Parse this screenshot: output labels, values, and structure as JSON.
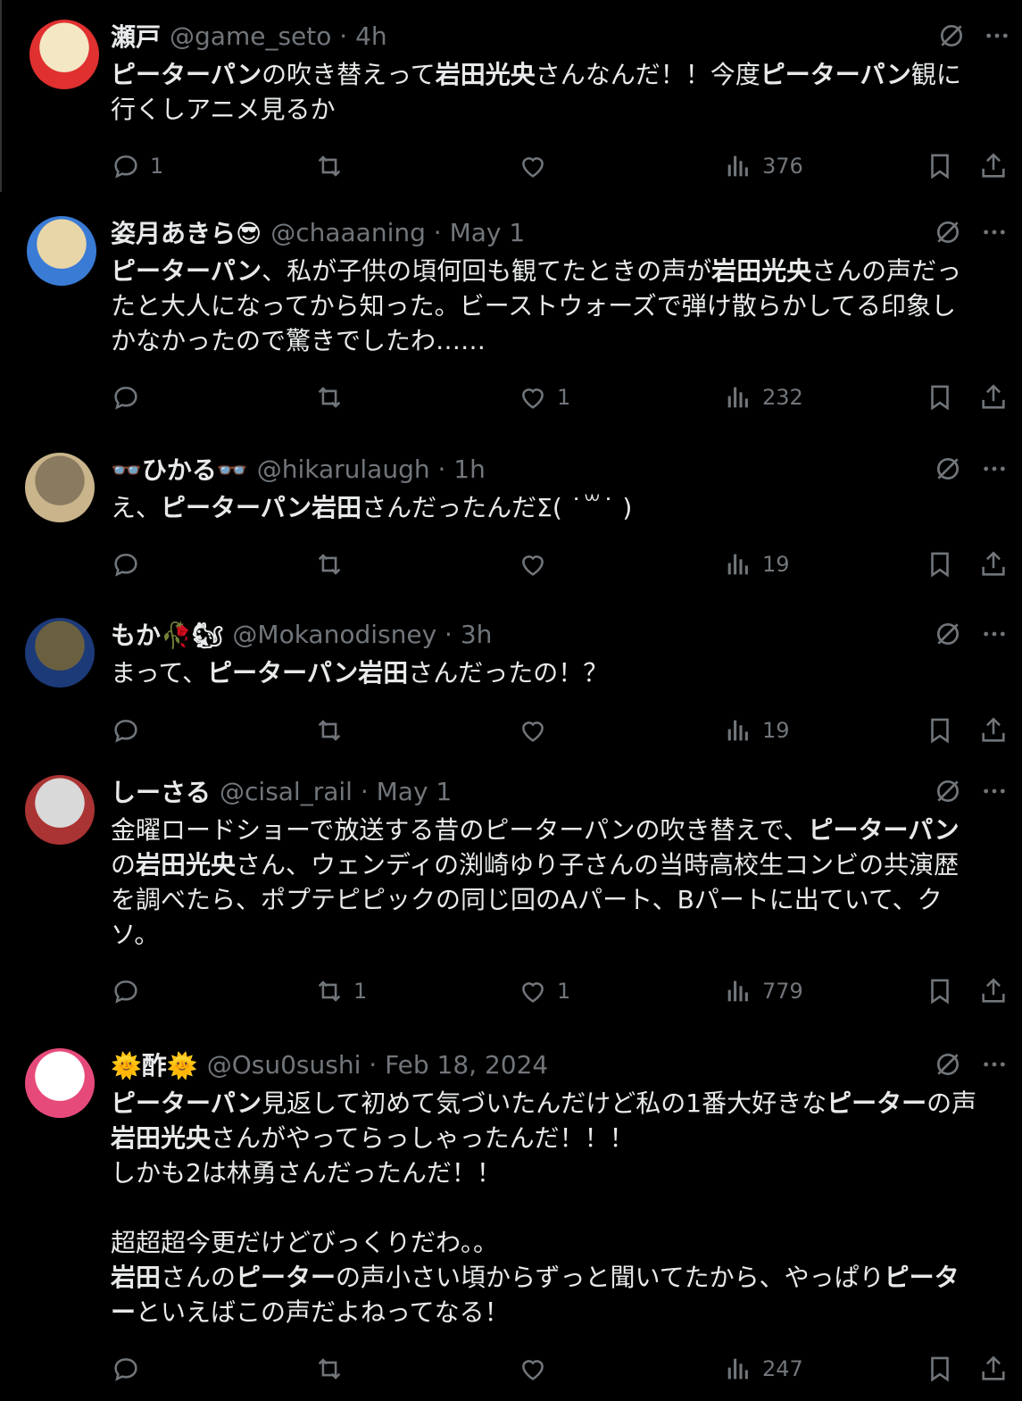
{
  "tweets": [
    {
      "name": "瀬戸",
      "handle": "@game_seto",
      "time": "4h",
      "body": [
        {
          "t": "ピーターパン",
          "b": true
        },
        {
          "t": "の吹き替えって",
          "b": false
        },
        {
          "t": "岩田光央",
          "b": true
        },
        {
          "t": "さんなんだ！！今度",
          "b": false
        },
        {
          "t": "ピーターパン",
          "b": true
        },
        {
          "t": "観に\n行くしアニメ見るか",
          "b": false
        }
      ],
      "stats": {
        "reply": "1",
        "retweet": "",
        "like": "",
        "views": "376"
      }
    },
    {
      "name": "姿月あきら😎",
      "handle": "@chaaaning",
      "time": "May 1",
      "body": [
        {
          "t": "ピーターパン",
          "b": true
        },
        {
          "t": "、私が子供の頃何回も観てたときの声が",
          "b": false
        },
        {
          "t": "岩田光央",
          "b": true
        },
        {
          "t": "さんの声だっ\nたと大人になってから知った。ビーストウォーズで弾け散らかしてる印象し\nかなかったので驚きでしたわ……",
          "b": false
        }
      ],
      "stats": {
        "reply": "",
        "retweet": "",
        "like": "1",
        "views": "232"
      }
    },
    {
      "name": "👓ひかる👓",
      "handle": "@hikarulaugh",
      "time": "1h",
      "body": [
        {
          "t": "え、",
          "b": false
        },
        {
          "t": "ピーターパン岩田",
          "b": true
        },
        {
          "t": "さんだったんだΣ( ˙꒳˙ )",
          "b": false
        }
      ],
      "stats": {
        "reply": "",
        "retweet": "",
        "like": "",
        "views": "19"
      }
    },
    {
      "name": "もか🥀🐿",
      "handle": "@Mokanodisney",
      "time": "3h",
      "body": [
        {
          "t": "まって、",
          "b": false
        },
        {
          "t": "ピーターパン岩田",
          "b": true
        },
        {
          "t": "さんだったの！？",
          "b": false
        }
      ],
      "stats": {
        "reply": "",
        "retweet": "",
        "like": "",
        "views": "19"
      }
    },
    {
      "name": "しーさる",
      "handle": "@cisal_rail",
      "time": "May 1",
      "body": [
        {
          "t": "金曜ロードショーで放送する昔のピーターパンの吹き替えで、",
          "b": false
        },
        {
          "t": "ピーターパン\n",
          "b": true
        },
        {
          "t": "の",
          "b": false
        },
        {
          "t": "岩田光央",
          "b": true
        },
        {
          "t": "さん、ウェンディの渕崎ゆり子さんの当時高校生コンビの共演歴\nを調べたら、ポプテピピックの同じ回のAパート、Bパートに出ていて、ク\nソ。",
          "b": false
        }
      ],
      "stats": {
        "reply": "",
        "retweet": "1",
        "like": "1",
        "views": "779"
      }
    },
    {
      "name": "🌞酢🌞",
      "handle": "@Osu0sushi",
      "time": "Feb 18, 2024",
      "body": [
        {
          "t": "ピーターパン",
          "b": true
        },
        {
          "t": "見返して初めて気づいたんだけど私の1番大好きな",
          "b": false
        },
        {
          "t": "ピーター",
          "b": true
        },
        {
          "t": "の声\n",
          "b": false
        },
        {
          "t": "岩田光央",
          "b": true
        },
        {
          "t": "さんがやってらっしゃったんだ！！！\nしかも2は林勇さんだったんだ！！\n\n超超超今更だけどびっくりだわ。。\n",
          "b": false
        },
        {
          "t": "岩田",
          "b": true
        },
        {
          "t": "さんの",
          "b": false
        },
        {
          "t": "ピーター",
          "b": true
        },
        {
          "t": "の声小さい頃からずっと聞いてたから、やっぱり",
          "b": false
        },
        {
          "t": "ピータ\nー",
          "b": true
        },
        {
          "t": "といえばこの声だよねってなる！",
          "b": false
        }
      ],
      "stats": {
        "reply": "",
        "retweet": "",
        "like": "",
        "views": "247"
      }
    }
  ],
  "colors": {
    "background": "#000000",
    "text": "#e7e9ea",
    "muted": "#71767b"
  },
  "icons": [
    "reply-icon",
    "retweet-icon",
    "like-icon",
    "views-icon",
    "bookmark-icon",
    "share-icon",
    "grok-icon",
    "more-icon"
  ]
}
